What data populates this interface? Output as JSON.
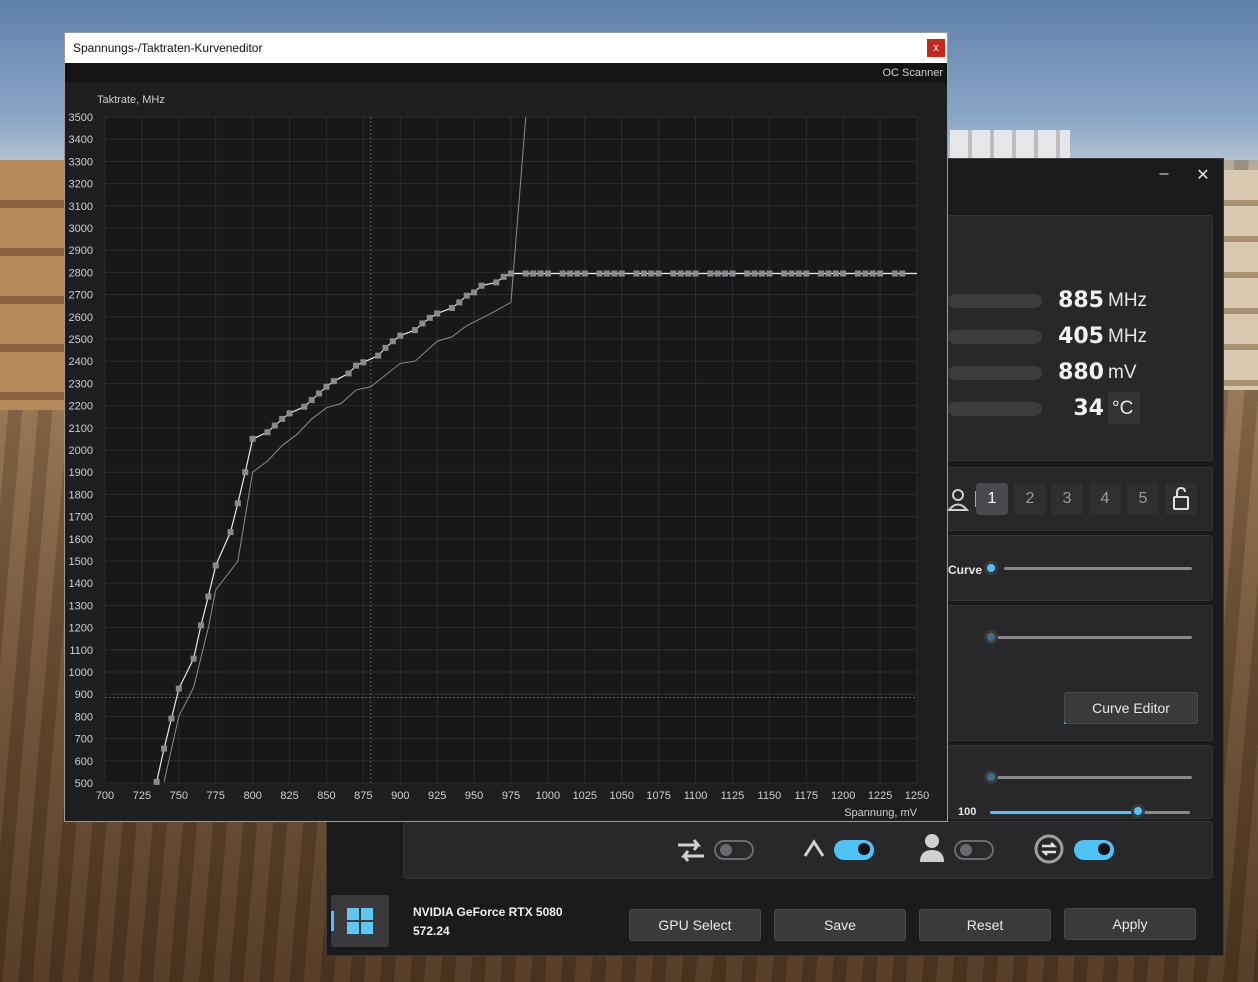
{
  "editor": {
    "title": "Spannungs-/Taktraten-Kurveneditor",
    "close_glyph": "x",
    "oc_scanner": "OC Scanner"
  },
  "chart_data": {
    "type": "line",
    "ylabel": "Taktrate, MHz",
    "xlabel": "Spannung, mV",
    "xlim": [
      700,
      1250
    ],
    "ylim": [
      500,
      3500
    ],
    "x_ticks": [
      700,
      725,
      750,
      775,
      800,
      825,
      850,
      875,
      900,
      925,
      950,
      975,
      1000,
      1025,
      1050,
      1075,
      1100,
      1125,
      1150,
      1175,
      1200,
      1225,
      1250
    ],
    "y_ticks": [
      500,
      600,
      700,
      800,
      900,
      1000,
      1100,
      1200,
      1300,
      1400,
      1500,
      1600,
      1700,
      1800,
      1900,
      2000,
      2100,
      2200,
      2300,
      2400,
      2500,
      2600,
      2700,
      2800,
      2900,
      3000,
      3100,
      3200,
      3300,
      3400,
      3500
    ],
    "grid": true,
    "crosshair": {
      "x": 880,
      "y": 885
    },
    "series": [
      {
        "style": "points-line",
        "points": [
          [
            735,
            505
          ],
          [
            740,
            655
          ],
          [
            745,
            790
          ],
          [
            750,
            925
          ],
          [
            760,
            1060
          ],
          [
            765,
            1210
          ],
          [
            770,
            1340
          ],
          [
            775,
            1480
          ],
          [
            785,
            1630
          ],
          [
            790,
            1760
          ],
          [
            795,
            1900
          ],
          [
            800,
            2050
          ],
          [
            810,
            2080
          ],
          [
            815,
            2110
          ],
          [
            820,
            2140
          ],
          [
            825,
            2165
          ],
          [
            835,
            2195
          ],
          [
            840,
            2225
          ],
          [
            845,
            2255
          ],
          [
            850,
            2285
          ],
          [
            855,
            2310
          ],
          [
            865,
            2345
          ],
          [
            870,
            2380
          ],
          [
            875,
            2395
          ],
          [
            885,
            2425
          ],
          [
            890,
            2460
          ],
          [
            895,
            2490
          ],
          [
            900,
            2515
          ],
          [
            910,
            2540
          ],
          [
            915,
            2570
          ],
          [
            920,
            2595
          ],
          [
            925,
            2615
          ],
          [
            935,
            2640
          ],
          [
            940,
            2665
          ],
          [
            945,
            2695
          ],
          [
            950,
            2710
          ],
          [
            955,
            2740
          ],
          [
            965,
            2755
          ],
          [
            970,
            2780
          ],
          [
            975,
            2795
          ],
          [
            985,
            2795
          ],
          [
            990,
            2795
          ],
          [
            995,
            2795
          ],
          [
            1000,
            2795
          ],
          [
            1010,
            2795
          ],
          [
            1015,
            2795
          ],
          [
            1020,
            2795
          ],
          [
            1025,
            2795
          ],
          [
            1035,
            2795
          ],
          [
            1040,
            2795
          ],
          [
            1045,
            2795
          ],
          [
            1050,
            2795
          ],
          [
            1060,
            2795
          ],
          [
            1065,
            2795
          ],
          [
            1070,
            2795
          ],
          [
            1075,
            2795
          ],
          [
            1085,
            2795
          ],
          [
            1090,
            2795
          ],
          [
            1095,
            2795
          ],
          [
            1100,
            2795
          ],
          [
            1110,
            2795
          ],
          [
            1115,
            2795
          ],
          [
            1120,
            2795
          ],
          [
            1125,
            2795
          ],
          [
            1135,
            2795
          ],
          [
            1140,
            2795
          ],
          [
            1145,
            2795
          ],
          [
            1150,
            2795
          ],
          [
            1160,
            2795
          ],
          [
            1165,
            2795
          ],
          [
            1170,
            2795
          ],
          [
            1175,
            2795
          ],
          [
            1185,
            2795
          ],
          [
            1190,
            2795
          ],
          [
            1195,
            2795
          ],
          [
            1200,
            2795
          ],
          [
            1210,
            2795
          ],
          [
            1215,
            2795
          ],
          [
            1220,
            2795
          ],
          [
            1225,
            2795
          ],
          [
            1235,
            2795
          ],
          [
            1240,
            2795
          ]
        ]
      },
      {
        "style": "thin-line",
        "points": [
          [
            740,
            505
          ],
          [
            750,
            800
          ],
          [
            760,
            930
          ],
          [
            770,
            1200
          ],
          [
            775,
            1370
          ],
          [
            790,
            1500
          ],
          [
            800,
            1900
          ],
          [
            810,
            1950
          ],
          [
            820,
            2020
          ],
          [
            830,
            2070
          ],
          [
            840,
            2140
          ],
          [
            850,
            2190
          ],
          [
            860,
            2210
          ],
          [
            870,
            2270
          ],
          [
            880,
            2285
          ],
          [
            900,
            2390
          ],
          [
            910,
            2400
          ],
          [
            925,
            2490
          ],
          [
            935,
            2510
          ],
          [
            945,
            2560
          ],
          [
            960,
            2610
          ],
          [
            975,
            2665
          ],
          [
            985,
            3500
          ]
        ]
      }
    ]
  },
  "app": {
    "minimize_glyph": "–",
    "close_glyph": "✕",
    "monitor": [
      {
        "value": "885",
        "unit": "MHz"
      },
      {
        "value": "405",
        "unit": "MHz"
      },
      {
        "value": "880",
        "unit": "mV"
      },
      {
        "value": "34",
        "unit": "°C"
      }
    ],
    "profiles": [
      "1",
      "2",
      "3",
      "4",
      "5"
    ],
    "curve_label": "Curve",
    "curve_editor_button": "Curve Editor",
    "fan_value": "100",
    "fan_slider_level": 0.74,
    "toggles": [
      false,
      true,
      false,
      true
    ],
    "gpu_name": "NVIDIA GeForce RTX 5080",
    "driver": "572.24",
    "buttons": {
      "gpu_select": "GPU Select",
      "save": "Save",
      "reset": "Reset",
      "apply": "Apply"
    }
  }
}
